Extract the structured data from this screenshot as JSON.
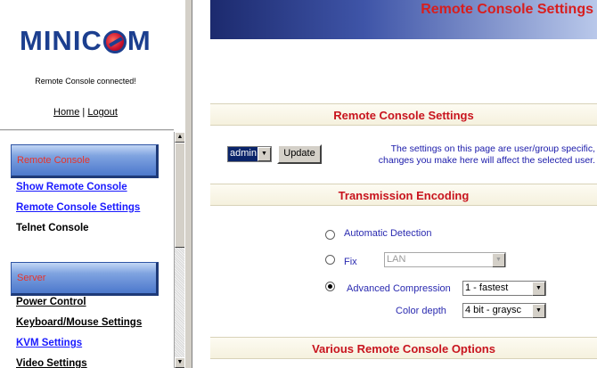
{
  "sidebar": {
    "logo_text_1": "MINIC",
    "logo_text_2": "M",
    "status": "Remote Console connected!",
    "home_label": "Home",
    "link_separator": "|",
    "logout_label": "Logout",
    "sections": [
      {
        "header": "Remote Console",
        "items": [
          {
            "label": "Show Remote Console"
          },
          {
            "label": "Remote Console Settings"
          },
          {
            "label": "Telnet Console"
          }
        ]
      },
      {
        "header": "Server",
        "items": [
          {
            "label": "Power Control"
          },
          {
            "label": "Keyboard/Mouse Settings"
          },
          {
            "label": "KVM Settings"
          },
          {
            "label": "Video Settings"
          }
        ]
      }
    ]
  },
  "main": {
    "page_title": "Remote Console Settings",
    "section_settings": "Remote Console Settings",
    "user_select_value": "admin",
    "update_label": "Update",
    "user_note_line1": "The settings on this page are user/group specific,",
    "user_note_line2": "changes you make here will affect the selected user.",
    "section_encoding": "Transmission Encoding",
    "encoding_options": {
      "auto_label": "Automatic Detection",
      "fix_label": "Fix",
      "fix_value": "LAN",
      "advanced_label": "Advanced Compression",
      "advanced_value": "1 - fastest",
      "color_depth_label": "Color depth",
      "color_depth_value": "4 bit - graysc",
      "selected": "advanced"
    },
    "section_various": "Various Remote Console Options"
  },
  "colors": {
    "title_red": "#d81e1e",
    "section_red": "#c8141e",
    "link_blue": "#1a1aff",
    "menu_header_red": "#e8332a",
    "logo_blue": "#1c3f8f",
    "note_blue": "#1a1aaa"
  }
}
